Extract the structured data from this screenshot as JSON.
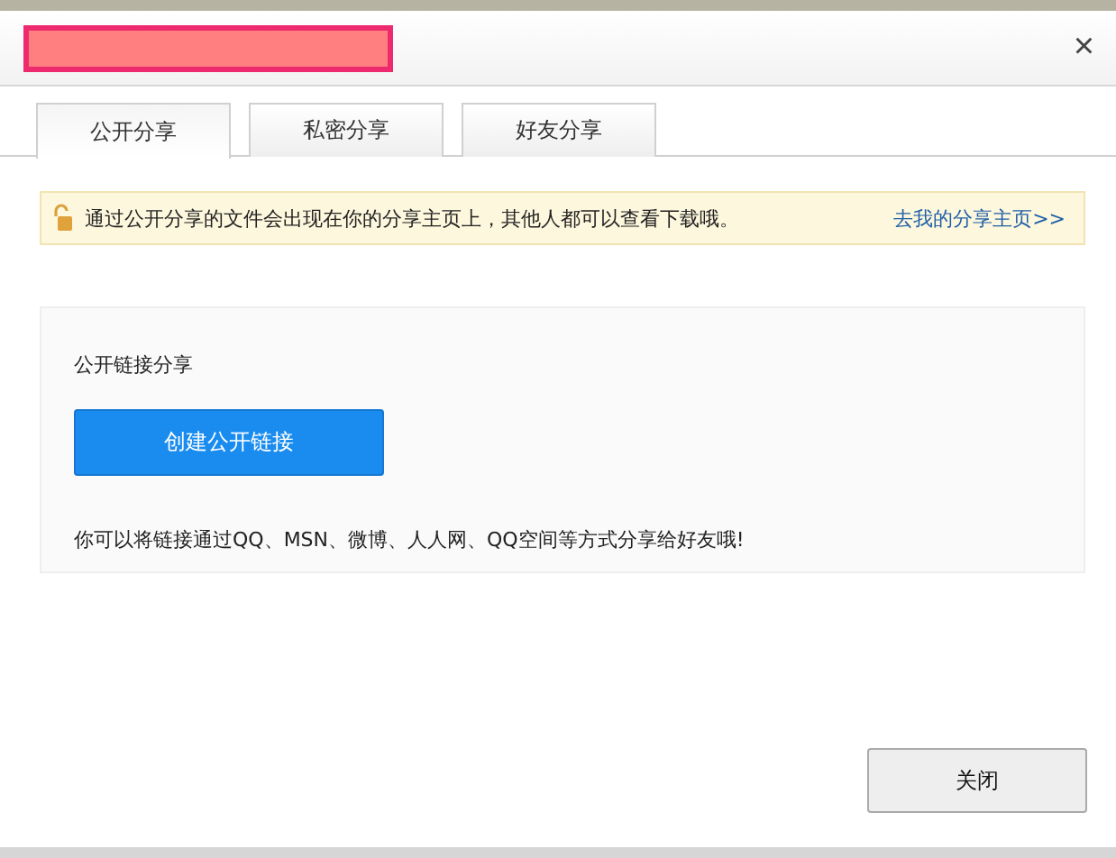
{
  "dialog": {
    "close_icon": "×"
  },
  "tabs": [
    {
      "label": "公开分享",
      "selected": true
    },
    {
      "label": "私密分享",
      "selected": false
    },
    {
      "label": "好友分享",
      "selected": false
    }
  ],
  "notice": {
    "text": "通过公开分享的文件会出现在你的分享主页上，其他人都可以查看下载哦。",
    "link": "去我的分享主页>>"
  },
  "panel": {
    "heading": "公开链接分享",
    "button": "创建公开链接",
    "hint": "你可以将链接通过QQ、MSN、微博、人人网、QQ空间等方式分享给好友哦!"
  },
  "footer": {
    "button": "关闭"
  }
}
